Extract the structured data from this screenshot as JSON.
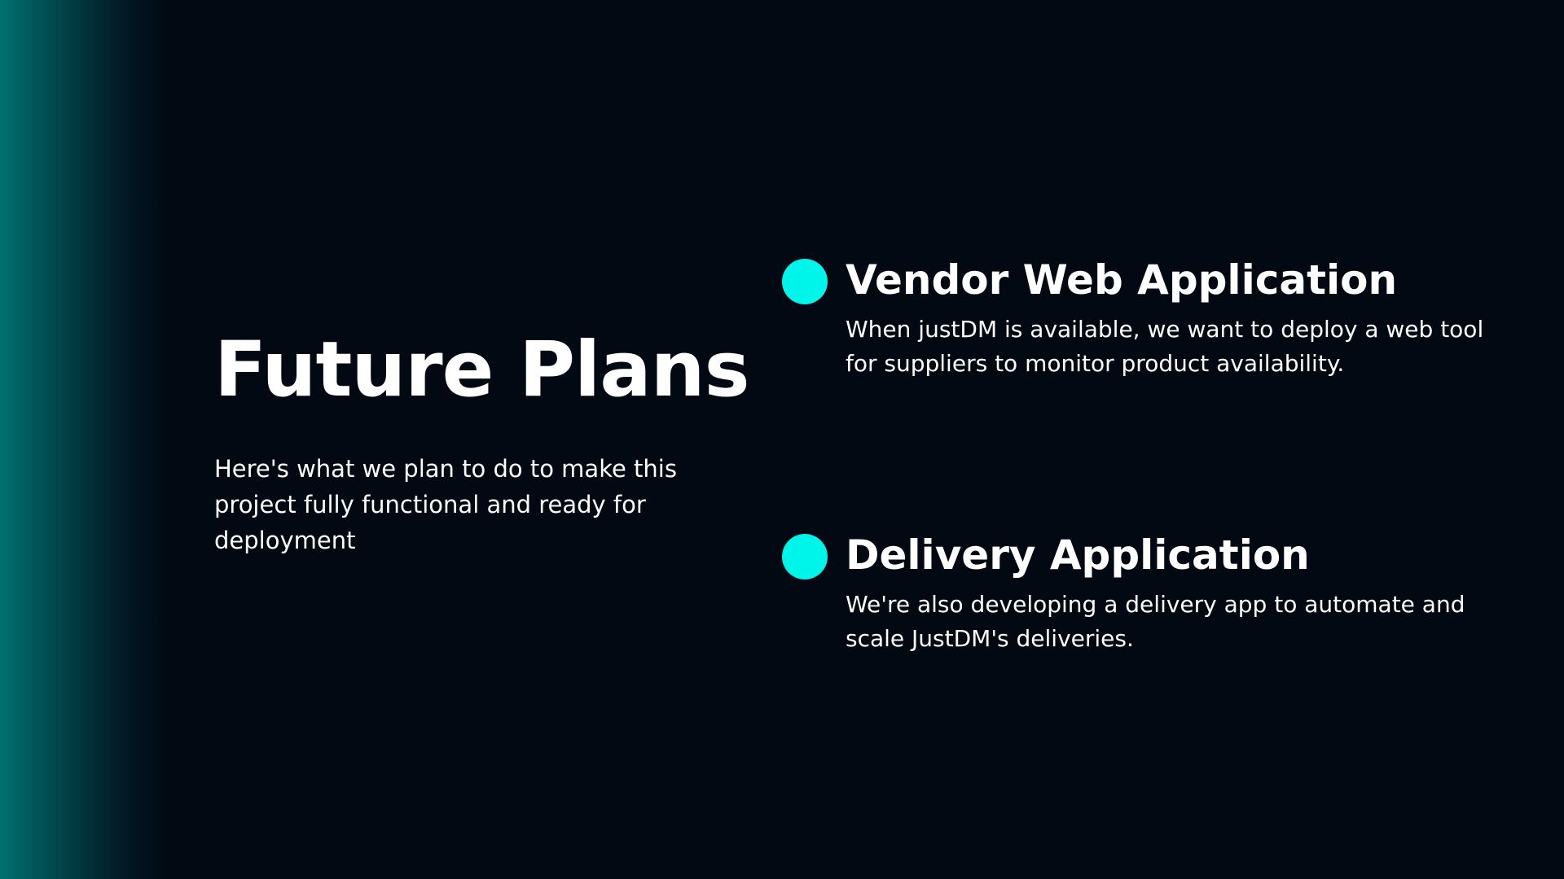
{
  "slide": {
    "title": "Future Plans",
    "subtitle": "Here's what we plan to do to make this project fully functional and ready for deployment",
    "items": [
      {
        "title": "Vendor Web Application",
        "description": "When justDM is available, we want to deploy a web tool for suppliers to monitor product availability."
      },
      {
        "title": "Delivery Application",
        "description": "We're also developing a delivery app to automate and scale JustDM's deliveries."
      }
    ]
  },
  "colors": {
    "background": "#020913",
    "accent": "#00f5ea",
    "gradient_edge": "#00716e",
    "text": "#ffffff"
  }
}
